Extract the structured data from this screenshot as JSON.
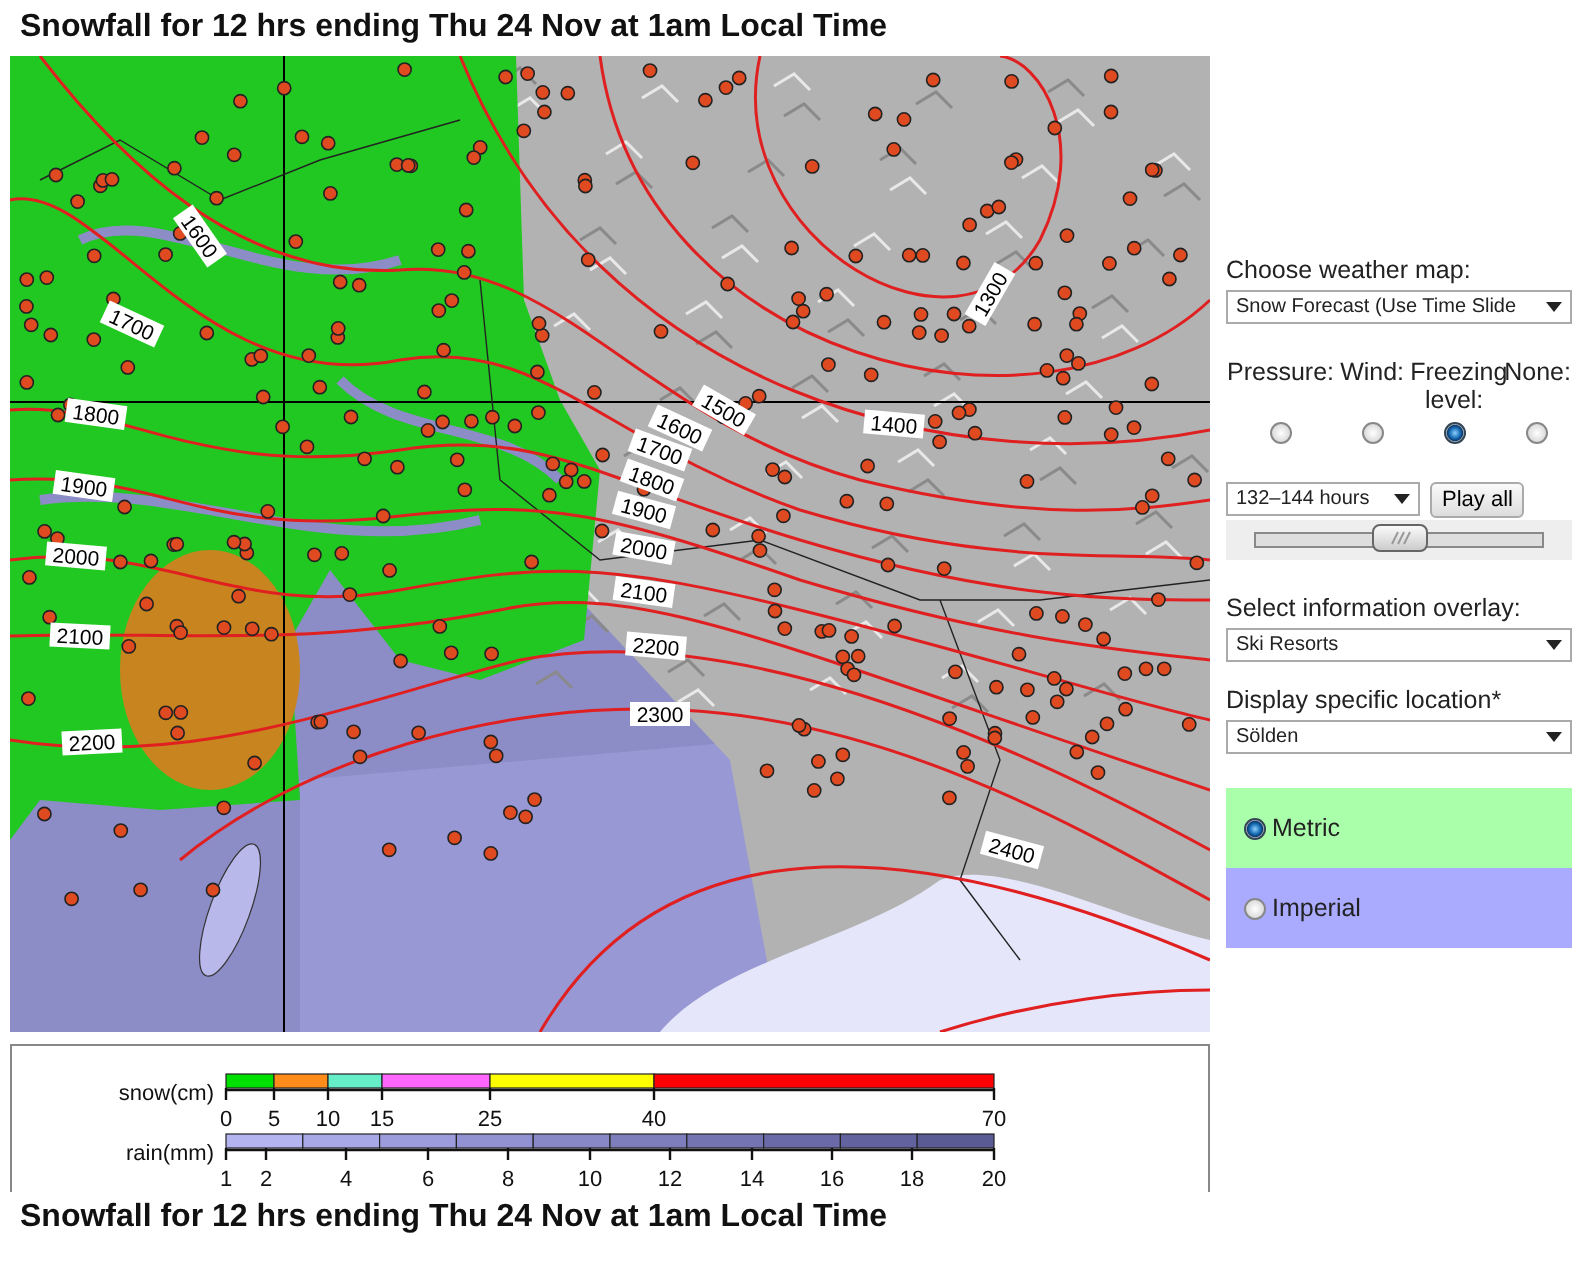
{
  "title": "Snowfall for 12 hrs ending Thu 24 Nov at 1am Local Time",
  "map": {
    "contour_labels": [
      "1600",
      "1700",
      "1800",
      "1900",
      "2000",
      "2100",
      "2200",
      "1300",
      "1400",
      "1500",
      "1600",
      "1700",
      "1800",
      "1900",
      "2000",
      "2100",
      "2200",
      "2300",
      "2400"
    ]
  },
  "legend": {
    "snow": {
      "label": "snow(cm)",
      "segments": [
        {
          "color": "#00e000"
        },
        {
          "color": "#ff8c1a"
        },
        {
          "color": "#66eec8"
        },
        {
          "color": "#ff66ff"
        },
        {
          "color": "#ffff00"
        },
        {
          "color": "#ff0000"
        }
      ],
      "ticks": [
        "0",
        "5",
        "10",
        "15",
        "25",
        "40",
        "70"
      ]
    },
    "rain": {
      "label": "rain(mm)",
      "segments": [
        {
          "color": "#b4b4f0"
        },
        {
          "color": "#a8a8e6"
        },
        {
          "color": "#9c9cdc"
        },
        {
          "color": "#9292d2"
        },
        {
          "color": "#8888c6"
        },
        {
          "color": "#7e7ebc"
        },
        {
          "color": "#7474b2"
        },
        {
          "color": "#6a6aa8"
        },
        {
          "color": "#62629e"
        },
        {
          "color": "#5a5a94"
        }
      ],
      "ticks": [
        "1",
        "2",
        "4",
        "6",
        "8",
        "10",
        "12",
        "14",
        "16",
        "18",
        "20"
      ]
    }
  },
  "panel": {
    "weather_map": {
      "label": "Choose weather map:",
      "value": "Snow Forecast (Use Time Slide"
    },
    "overlays": [
      {
        "label": "Pressure:",
        "selected": false
      },
      {
        "label": "Wind:",
        "selected": false
      },
      {
        "label": "Freezing level:",
        "selected": true
      },
      {
        "label": "None:",
        "selected": false
      }
    ],
    "period": {
      "value": "132–144 hours"
    },
    "play_button": "Play all",
    "time_slider": {
      "level": 0.5
    },
    "info_overlay": {
      "label": "Select information overlay:",
      "value": "Ski Resorts"
    },
    "location": {
      "label": "Display specific location*",
      "value": "Sölden"
    },
    "units": [
      {
        "label": "Metric",
        "selected": true,
        "color": "#aaffaa"
      },
      {
        "label": "Imperial",
        "selected": false,
        "color": "#aaaaff"
      }
    ]
  },
  "footer_title": "Snowfall for 12 hrs ending Thu 24 Nov at 1am Local Time"
}
